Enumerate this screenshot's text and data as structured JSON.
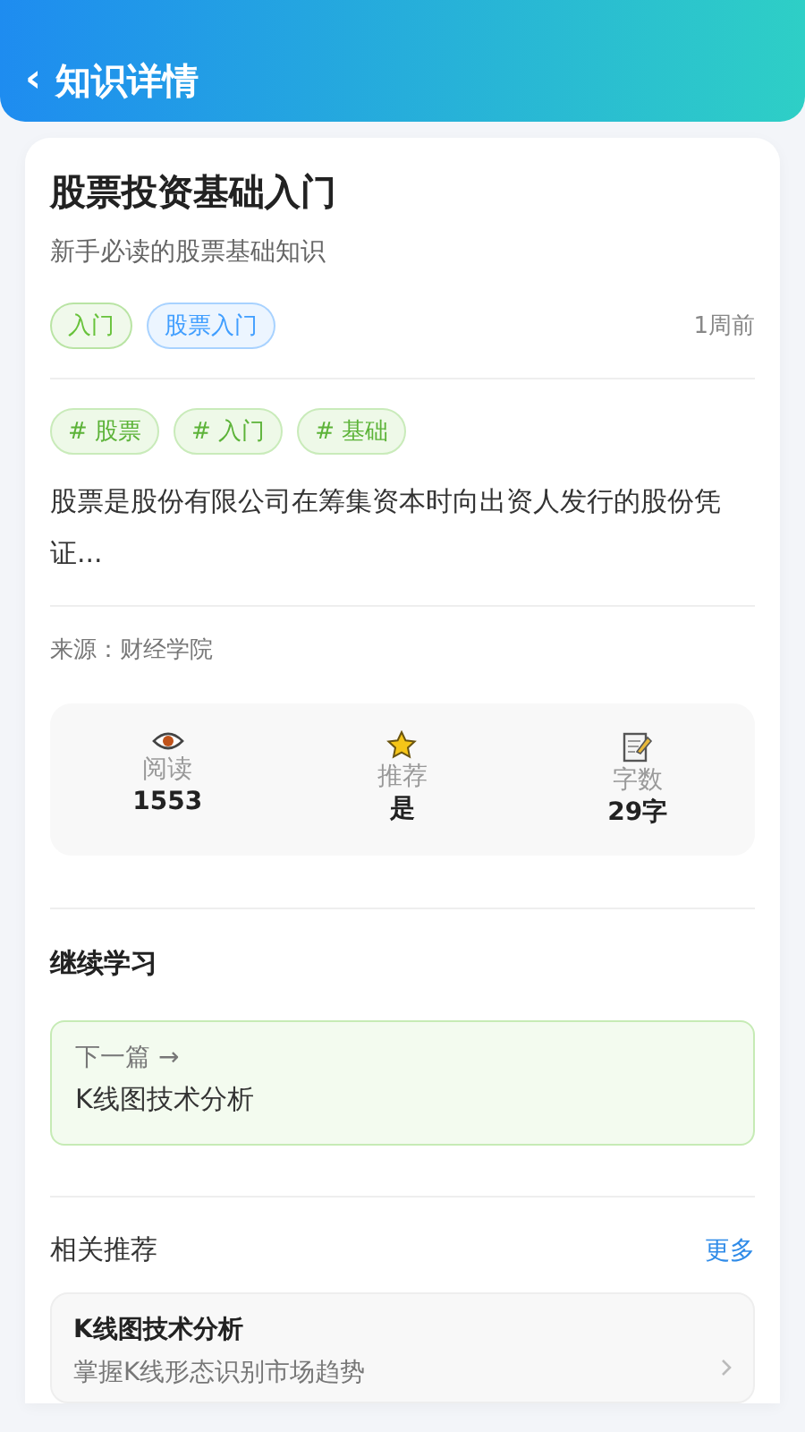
{
  "header": {
    "back": "‹",
    "title": "知识详情"
  },
  "article": {
    "title": "股票投资基础入门",
    "subtitle": "新手必读的股票基础知识",
    "tags": [
      {
        "label": "入门",
        "color": "#67c23a"
      },
      {
        "label": "股票入门",
        "color": "#409eff"
      }
    ],
    "time": "1周前",
    "hashtags": [
      "# 股票",
      "# 入门",
      "# 基础"
    ],
    "summary": "股票是股份有限公司在筹集资本时向出资人发行的股份凭证...",
    "source": "来源：财经学院",
    "stats": [
      {
        "kind": "views",
        "label": "阅读",
        "value": "1553"
      },
      {
        "kind": "recommend",
        "label": "推荐",
        "value": "是"
      },
      {
        "kind": "words",
        "label": "字数",
        "value": "29字"
      }
    ]
  },
  "continue": {
    "heading": "继续学习",
    "next_label": "下一篇 →",
    "next_title": "K线图技术分析"
  },
  "related": {
    "heading": "相关推荐",
    "more": "更多",
    "items": [
      {
        "title": "K线图技术分析",
        "desc": "掌握K线形态识别市场趋势"
      }
    ]
  }
}
